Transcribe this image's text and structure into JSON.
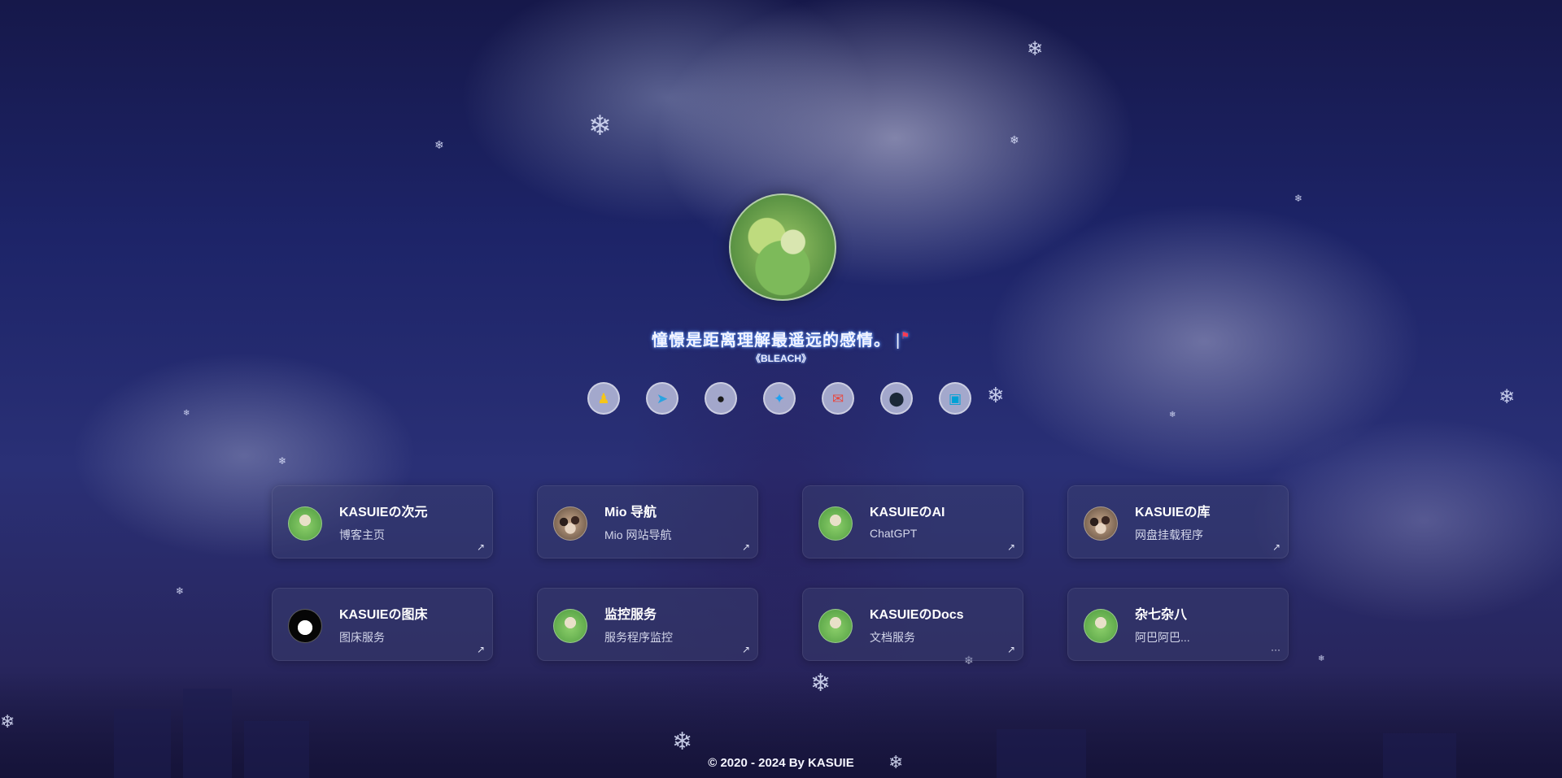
{
  "header": {
    "motto": "憧憬是距离理解最遥远的感情。",
    "cursor": "|",
    "flag": "⚑",
    "source": "《BLEACH》"
  },
  "socials": [
    {
      "name": "qq",
      "glyph": "♟",
      "color": "#f5c518"
    },
    {
      "name": "telegram",
      "glyph": "➤",
      "color": "#2aa3e0"
    },
    {
      "name": "github",
      "glyph": "●",
      "color": "#1b1b1b"
    },
    {
      "name": "twitter",
      "glyph": "✦",
      "color": "#1da1f2"
    },
    {
      "name": "email",
      "glyph": "✉",
      "color": "#e8473f"
    },
    {
      "name": "steam",
      "glyph": "⬤",
      "color": "#1b2838"
    },
    {
      "name": "bilibili",
      "glyph": "▣",
      "color": "#00a1d6"
    }
  ],
  "cards": [
    {
      "title": "KASUIEの次元",
      "subtitle": "博客主页",
      "action": "↗"
    },
    {
      "title": "Mio 导航",
      "subtitle": "Mio 网站导航",
      "action": "↗"
    },
    {
      "title": "KASUIEのAI",
      "subtitle": "ChatGPT",
      "action": "↗"
    },
    {
      "title": "KASUIEの库",
      "subtitle": "网盘挂载程序",
      "action": "↗"
    },
    {
      "title": "KASUIEの图床",
      "subtitle": "图床服务",
      "action": "↗"
    },
    {
      "title": "监控服务",
      "subtitle": "服务程序监控",
      "action": "↗"
    },
    {
      "title": "KASUIEのDocs",
      "subtitle": "文档服务",
      "action": "↗"
    },
    {
      "title": "杂七杂八",
      "subtitle": "阿巴阿巴...",
      "action": "···"
    }
  ],
  "footer": {
    "text": "© 2020 - 2024 By KASUIE"
  }
}
